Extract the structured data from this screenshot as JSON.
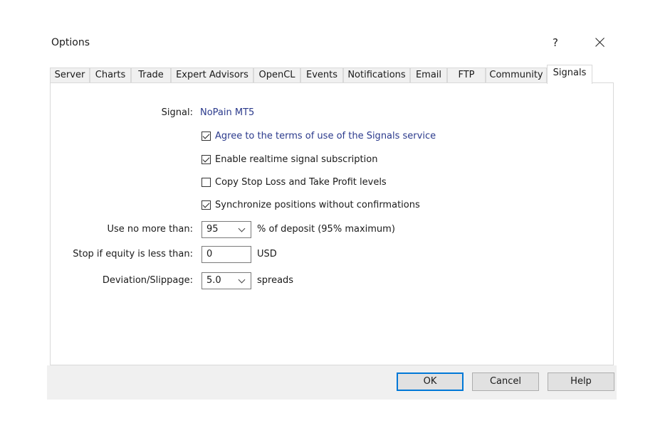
{
  "window": {
    "title": "Options",
    "help_glyph": "?"
  },
  "tabs": [
    {
      "label": "Server",
      "active": false
    },
    {
      "label": "Charts",
      "active": false
    },
    {
      "label": "Trade",
      "active": false
    },
    {
      "label": "Expert Advisors",
      "active": false
    },
    {
      "label": "OpenCL",
      "active": false
    },
    {
      "label": "Events",
      "active": false
    },
    {
      "label": "Notifications",
      "active": false
    },
    {
      "label": "Email",
      "active": false
    },
    {
      "label": "FTP",
      "active": false
    },
    {
      "label": "Community",
      "active": false
    },
    {
      "label": "Signals",
      "active": true
    }
  ],
  "signals": {
    "signal_label": "Signal:",
    "signal_name": "NoPain MT5",
    "checkboxes": [
      {
        "label": "Agree to the terms of use of the Signals service",
        "checked": true,
        "is_link": true
      },
      {
        "label": "Enable realtime signal subscription",
        "checked": true,
        "is_link": false
      },
      {
        "label": "Copy Stop Loss and Take Profit levels",
        "checked": false,
        "is_link": false
      },
      {
        "label": "Synchronize positions without confirmations",
        "checked": true,
        "is_link": false
      }
    ],
    "use_no_more": {
      "label": "Use no more than:",
      "value": "95",
      "suffix": "% of deposit (95% maximum)"
    },
    "stop_equity": {
      "label": "Stop if equity is less than:",
      "value": "0",
      "suffix": "USD"
    },
    "deviation": {
      "label": "Deviation/Slippage:",
      "value": "5.0",
      "suffix": "spreads"
    }
  },
  "buttons": {
    "ok": "OK",
    "cancel": "Cancel",
    "help": "Help"
  },
  "colors": {
    "link": "#2b3a8c",
    "default_button_border": "#0078d7",
    "footer_bg": "#f0f0f0"
  },
  "icons": {
    "close": "close-icon",
    "help": "question-mark-icon",
    "dropdown": "chevron-down-icon",
    "checkbox": "checkmark-icon"
  }
}
